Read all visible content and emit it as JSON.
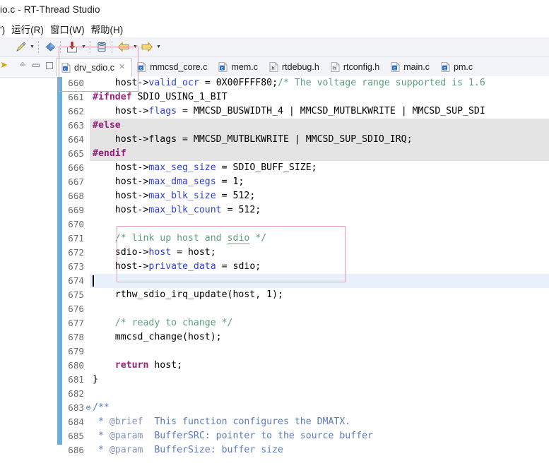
{
  "window": {
    "title": "io.c - RT-Thread Studio"
  },
  "menubar": {
    "items": [
      {
        "label": "')"
      },
      {
        "label": "运行(R)"
      },
      {
        "label": "窗口(W)"
      },
      {
        "label": "帮助(H)"
      }
    ]
  },
  "toolbar": {
    "buttons": [
      {
        "name": "quick-fix-pencil-icon",
        "icon": "pencil-icon",
        "has_dropdown": true
      },
      {
        "name": "bookmark-icon",
        "icon": "diamond-icon",
        "has_dropdown": false
      },
      {
        "name": "download-flash-icon",
        "icon": "download-icon",
        "has_dropdown": true
      },
      {
        "name": "database-icon",
        "icon": "database-icon",
        "has_dropdown": false
      },
      {
        "name": "back-navigation-icon",
        "icon": "left-arrow-icon",
        "has_dropdown": true
      },
      {
        "name": "forward-navigation-icon",
        "icon": "right-arrow-icon",
        "has_dropdown": true
      }
    ]
  },
  "left_panel": {
    "buttons": [
      {
        "name": "panel-collapse-icon",
        "icon": "collapse-icon"
      },
      {
        "name": "panel-minimize-icon",
        "icon": "minimize-icon"
      },
      {
        "name": "panel-maximize-icon",
        "icon": "maximize-icon"
      }
    ]
  },
  "tabs": [
    {
      "label": "drv_sdio.c",
      "icon": "c-file-icon",
      "active": true,
      "closable": true,
      "close_glyph": "✕"
    },
    {
      "label": "mmcsd_core.c",
      "icon": "c-file-icon",
      "active": false,
      "closable": false
    },
    {
      "label": "mem.c",
      "icon": "c-file-icon",
      "active": false,
      "closable": false
    },
    {
      "label": "rtdebug.h",
      "icon": "h-file-icon",
      "active": false,
      "closable": false
    },
    {
      "label": "rtconfig.h",
      "icon": "h-file-icon",
      "active": false,
      "closable": false
    },
    {
      "label": "main.c",
      "icon": "c-file-icon",
      "active": false,
      "closable": false
    },
    {
      "label": "pm.c",
      "icon": "c-file-icon",
      "active": false,
      "closable": false
    }
  ],
  "editor": {
    "colors": {
      "preprocessor": "#9b1d7a",
      "keyword": "#9b1d7a",
      "field": "#2a3fd8",
      "comment": "#5a9e7c",
      "docblock": "#5a7ac0",
      "change_bar": "#68aee0",
      "block_highlight": "#e4e4e4",
      "cursor_line": "#e8f0fb",
      "annotation_box": "#e79aa6"
    },
    "first_line": 660,
    "cursor_line": 674,
    "lines": [
      {
        "n": 660,
        "highlight": "none",
        "fold": "",
        "tokens": [
          {
            "t": "    host->",
            "c": "plain"
          },
          {
            "t": "valid_ocr",
            "c": "field"
          },
          {
            "t": " = 0X00FFFF80;",
            "c": "plain"
          },
          {
            "t": "/* The voltage range supported is 1.6",
            "c": "comment"
          }
        ]
      },
      {
        "n": 661,
        "highlight": "none",
        "fold": "",
        "tokens": [
          {
            "t": "#ifndef",
            "c": "pre"
          },
          {
            "t": " SDIO_USING_1_BIT",
            "c": "plain"
          }
        ]
      },
      {
        "n": 662,
        "highlight": "none",
        "fold": "",
        "tokens": [
          {
            "t": "    host->",
            "c": "plain"
          },
          {
            "t": "flags",
            "c": "field"
          },
          {
            "t": " = MMCSD_BUSWIDTH_4 | MMCSD_MUTBLKWRITE | MMCSD_SUP_SDI",
            "c": "plain"
          }
        ]
      },
      {
        "n": 663,
        "highlight": "block",
        "fold": "",
        "tokens": [
          {
            "t": "#else",
            "c": "pre"
          }
        ]
      },
      {
        "n": 664,
        "highlight": "block",
        "fold": "",
        "tokens": [
          {
            "t": "    host->flags = MMCSD_MUTBLKWRITE | MMCSD_SUP_SDIO_IRQ;",
            "c": "plain"
          }
        ]
      },
      {
        "n": 665,
        "highlight": "block",
        "fold": "",
        "tokens": [
          {
            "t": "#endif",
            "c": "pre"
          }
        ]
      },
      {
        "n": 666,
        "highlight": "none",
        "fold": "",
        "tokens": [
          {
            "t": "    host->",
            "c": "plain"
          },
          {
            "t": "max_seg_size",
            "c": "field"
          },
          {
            "t": " = SDIO_BUFF_SIZE;",
            "c": "plain"
          }
        ]
      },
      {
        "n": 667,
        "highlight": "none",
        "fold": "",
        "tokens": [
          {
            "t": "    host->",
            "c": "plain"
          },
          {
            "t": "max_dma_segs",
            "c": "field"
          },
          {
            "t": " = 1;",
            "c": "plain"
          }
        ]
      },
      {
        "n": 668,
        "highlight": "none",
        "fold": "",
        "tokens": [
          {
            "t": "    host->",
            "c": "plain"
          },
          {
            "t": "max_blk_size",
            "c": "field"
          },
          {
            "t": " = 512;",
            "c": "plain"
          }
        ]
      },
      {
        "n": 669,
        "highlight": "none",
        "fold": "",
        "tokens": [
          {
            "t": "    host->",
            "c": "plain"
          },
          {
            "t": "max_blk_count",
            "c": "field"
          },
          {
            "t": " = 512;",
            "c": "plain"
          }
        ]
      },
      {
        "n": 670,
        "highlight": "none",
        "fold": "",
        "tokens": []
      },
      {
        "n": 671,
        "highlight": "none",
        "fold": "",
        "tokens": [
          {
            "t": "    /* link up host and ",
            "c": "comment"
          },
          {
            "t": "sdio",
            "c": "comment-spell"
          },
          {
            "t": " */",
            "c": "comment"
          }
        ]
      },
      {
        "n": 672,
        "highlight": "none",
        "fold": "",
        "tokens": [
          {
            "t": "    sdio->",
            "c": "plain"
          },
          {
            "t": "host",
            "c": "field"
          },
          {
            "t": " = host;",
            "c": "plain"
          }
        ]
      },
      {
        "n": 673,
        "highlight": "none",
        "fold": "",
        "tokens": [
          {
            "t": "    host->",
            "c": "plain"
          },
          {
            "t": "private_data",
            "c": "field"
          },
          {
            "t": " = sdio;",
            "c": "plain"
          }
        ]
      },
      {
        "n": 674,
        "highlight": "cursor",
        "fold": "",
        "tokens": []
      },
      {
        "n": 675,
        "highlight": "none",
        "fold": "",
        "tokens": [
          {
            "t": "    rthw_sdio_irq_update(host, 1);",
            "c": "plain"
          }
        ]
      },
      {
        "n": 676,
        "highlight": "none",
        "fold": "",
        "tokens": []
      },
      {
        "n": 677,
        "highlight": "none",
        "fold": "",
        "tokens": [
          {
            "t": "    /* ready to change */",
            "c": "comment"
          }
        ]
      },
      {
        "n": 678,
        "highlight": "none",
        "fold": "",
        "tokens": [
          {
            "t": "    mmcsd_change(host);",
            "c": "plain"
          }
        ]
      },
      {
        "n": 679,
        "highlight": "none",
        "fold": "",
        "tokens": []
      },
      {
        "n": 680,
        "highlight": "none",
        "fold": "",
        "tokens": [
          {
            "t": "    return",
            "c": "kw"
          },
          {
            "t": " host;",
            "c": "plain"
          }
        ]
      },
      {
        "n": 681,
        "highlight": "none",
        "fold": "",
        "tokens": [
          {
            "t": "}",
            "c": "plain"
          }
        ]
      },
      {
        "n": 682,
        "highlight": "none",
        "fold": "",
        "tokens": []
      },
      {
        "n": 683,
        "highlight": "none",
        "fold": "⊖",
        "tokens": [
          {
            "t": "/**",
            "c": "doc"
          }
        ]
      },
      {
        "n": 684,
        "highlight": "none",
        "fold": "",
        "tokens": [
          {
            "t": " * ",
            "c": "doc"
          },
          {
            "t": "@brief",
            "c": "doctag"
          },
          {
            "t": "  This function configures the DMATX.",
            "c": "doc"
          }
        ]
      },
      {
        "n": 685,
        "highlight": "none",
        "fold": "",
        "tokens": [
          {
            "t": " * ",
            "c": "doc"
          },
          {
            "t": "@param",
            "c": "doctag"
          },
          {
            "t": "  BufferSRC: pointer to the source buffer",
            "c": "doc"
          }
        ]
      },
      {
        "n": 686,
        "highlight": "none",
        "fold": "",
        "tokens": [
          {
            "t": " * ",
            "c": "doc"
          },
          {
            "t": "@param",
            "c": "doctag"
          },
          {
            "t": "  BufferSize: buffer size",
            "c": "doc"
          }
        ]
      }
    ]
  },
  "annotations": [
    {
      "name": "annotation-box-toolbar",
      "color": "#e79aa6"
    },
    {
      "name": "annotation-box-code",
      "color": "#e79aa6"
    }
  ]
}
